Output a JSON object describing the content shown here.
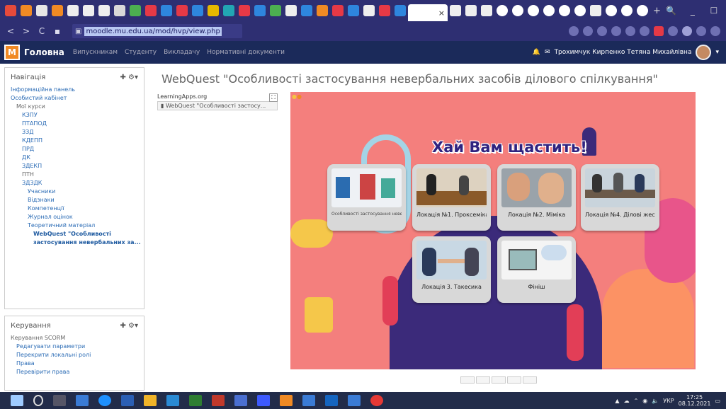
{
  "browser": {
    "active_tab_close": "×",
    "new_tab": "+",
    "window_controls": [
      "🔍",
      "_",
      "☐",
      "×"
    ],
    "url": "moodle.mu.edu.ua/mod/hvp/view.php",
    "nav": {
      "back": "<",
      "forward": ">",
      "reload": "C"
    }
  },
  "moodle": {
    "site_name": "Головна",
    "menu": [
      "Випускникам",
      "Студенту",
      "Викладачу",
      "Нормативні документи"
    ],
    "user_name": "Трохимчук Кирпенко Тетяна Михайлівна",
    "logo_letter": "М"
  },
  "nav_block": {
    "title": "Навігація",
    "items": [
      {
        "text": "Інформаційна панель",
        "indent": 0,
        "style": "link"
      },
      {
        "text": "Особистий кабінет",
        "indent": 0,
        "style": "link"
      },
      {
        "text": "Мої курси",
        "indent": 1,
        "style": "gray"
      },
      {
        "text": "КЗПУ",
        "indent": 2,
        "style": "link"
      },
      {
        "text": "ПТАПОД",
        "indent": 2,
        "style": "link"
      },
      {
        "text": "ЗЗД",
        "indent": 2,
        "style": "link"
      },
      {
        "text": "КДЕПП",
        "indent": 2,
        "style": "link"
      },
      {
        "text": "ПРД",
        "indent": 2,
        "style": "link"
      },
      {
        "text": "ДК",
        "indent": 2,
        "style": "link"
      },
      {
        "text": "ЗДЕКП",
        "indent": 2,
        "style": "link"
      },
      {
        "text": "ПТН",
        "indent": 2,
        "style": "gray"
      },
      {
        "text": "ЗДЗДК",
        "indent": 2,
        "style": "link"
      },
      {
        "text": "Учасники",
        "indent": 3,
        "style": "link"
      },
      {
        "text": "Відзнаки",
        "indent": 3,
        "style": "link"
      },
      {
        "text": "Компетенції",
        "indent": 3,
        "style": "link"
      },
      {
        "text": "Журнал оцінок",
        "indent": 3,
        "style": "link"
      },
      {
        "text": "Теоретичний матеріал",
        "indent": 3,
        "style": "link"
      },
      {
        "text": "WebQuest \"Особливості застосування невербальних за...",
        "indent": 4,
        "style": "bold"
      }
    ]
  },
  "admin_block": {
    "title": "Керування",
    "items": [
      {
        "text": "Керування SCORM",
        "indent": 0,
        "style": "gray"
      },
      {
        "text": "Редагувати параметри",
        "indent": 1,
        "style": "link"
      },
      {
        "text": "Перекрити локальні ролі",
        "indent": 1,
        "style": "link"
      },
      {
        "text": "Права",
        "indent": 1,
        "style": "link"
      },
      {
        "text": "Перевірити права",
        "indent": 1,
        "style": "link"
      }
    ]
  },
  "page": {
    "title": "WebQuest \"Особливості застосування невербальних засобів ділового спілкування\"",
    "lap_title": "LearningApps.org",
    "lap_sub": "WebQuest \"Особливості застосу...",
    "fullscreen": "⛶"
  },
  "quest": {
    "banner": "Хай Вам щастить!",
    "cards": [
      {
        "label": "Особливості застосування невербальних засобів",
        "small": true,
        "img": "charts"
      },
      {
        "label": "Локація №1. Проксеміка",
        "small": false,
        "img": "sofa"
      },
      {
        "label": "Локація №2. Міміка",
        "small": false,
        "img": "faces"
      },
      {
        "label": "Локація №4. Ділові жести",
        "small": false,
        "img": "meeting"
      },
      {
        "label": "Локація 3. Такесика",
        "small": false,
        "img": "handshake"
      },
      {
        "label": "Фініш",
        "small": false,
        "img": "finish"
      }
    ]
  },
  "taskbar": {
    "lang": "УКР",
    "time": "17:25",
    "date": "08.12.2021"
  }
}
